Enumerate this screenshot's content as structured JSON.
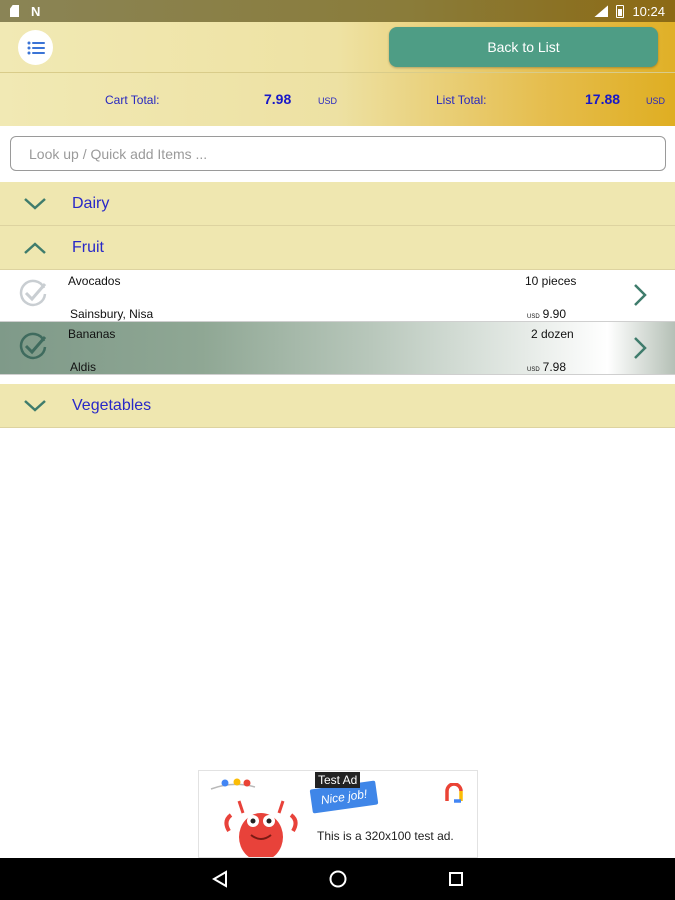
{
  "status_bar": {
    "time": "10:24",
    "left_icons": [
      "sd-card-icon",
      "n-icon"
    ],
    "right_icons": [
      "signal-icon",
      "battery-icon"
    ],
    "n_glyph": "N"
  },
  "header": {
    "menu_icon": "list-menu-icon",
    "back_label": "Back to List"
  },
  "totals": {
    "cart_label": "Cart Total:",
    "cart_value": "7.98",
    "cart_unit": "USD",
    "list_label": "List Total:",
    "list_value": "17.88",
    "list_unit": "USD"
  },
  "search": {
    "placeholder": "Look up / Quick add Items ..."
  },
  "categories": [
    {
      "name": "Dairy",
      "expanded": false
    },
    {
      "name": "Fruit",
      "expanded": true
    },
    {
      "name": "Vegetables",
      "expanded": false
    }
  ],
  "items": [
    {
      "name": "Avocados",
      "quantity": "10 pieces",
      "stores": "Sainsbury, Nisa",
      "currency": "USD",
      "price": "9.90",
      "picked": false
    },
    {
      "name": "Bananas",
      "quantity": "2 dozen",
      "stores": "Aldis",
      "currency": "USD",
      "price": "7.98",
      "picked": true
    }
  ],
  "ad": {
    "label": "Test Ad",
    "badge": "Nice job!",
    "text": "This is a 320x100 test ad."
  },
  "colors": {
    "accent": "#4e9d85",
    "category_bg": "#efe7b0",
    "total_text": "#2727c0"
  }
}
